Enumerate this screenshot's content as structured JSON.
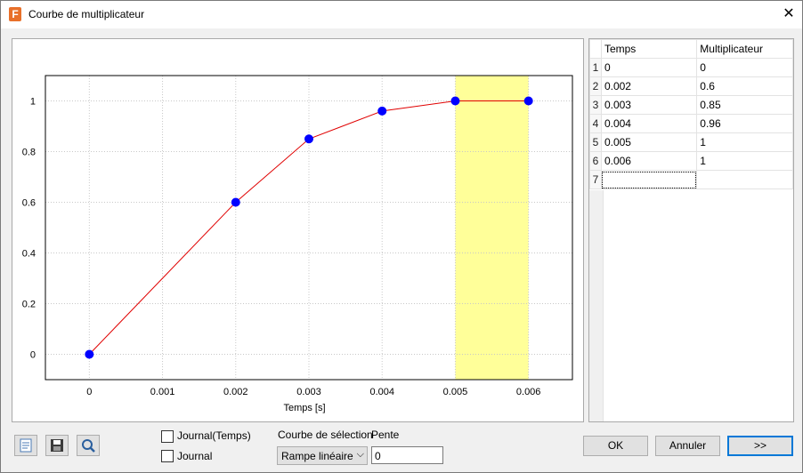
{
  "window": {
    "title": "Courbe de multiplicateur",
    "icon_letter": "F",
    "close_glyph": "✕"
  },
  "chart_data": {
    "type": "line",
    "x": [
      0,
      0.002,
      0.003,
      0.004,
      0.005,
      0.006
    ],
    "y": [
      0,
      0.6,
      0.85,
      0.96,
      1,
      1
    ],
    "xlabel": "Temps [s]",
    "ylabel": "",
    "xlim": [
      -0.0006,
      0.0066
    ],
    "ylim": [
      -0.1,
      1.1
    ],
    "x_ticks": [
      "0",
      "0.001",
      "0.002",
      "0.003",
      "0.004",
      "0.005",
      "0.006"
    ],
    "y_ticks": [
      "0",
      "0.2",
      "0.4",
      "0.6",
      "0.8",
      "1"
    ],
    "highlight_x_range": [
      0.005,
      0.006
    ],
    "line_color": "#e00000",
    "marker_color": "#0000ff",
    "highlight_color": "#ffff99",
    "grid": true
  },
  "table": {
    "headers": [
      "Temps",
      "Multiplicateur"
    ],
    "rows": [
      {
        "num": "1",
        "temps": "0",
        "mult": "0"
      },
      {
        "num": "2",
        "temps": "0.002",
        "mult": "0.6"
      },
      {
        "num": "3",
        "temps": "0.003",
        "mult": "0.85"
      },
      {
        "num": "4",
        "temps": "0.004",
        "mult": "0.96"
      },
      {
        "num": "5",
        "temps": "0.005",
        "mult": "1"
      },
      {
        "num": "6",
        "temps": "0.006",
        "mult": "1"
      },
      {
        "num": "7",
        "temps": "",
        "mult": ""
      }
    ]
  },
  "controls": {
    "journal_temps_label": "Journal(Temps)",
    "journal_label": "Journal",
    "selection_curve_label": "Courbe de sélection",
    "selection_curve_value": "Rampe linéaire",
    "slope_label": "Pente",
    "slope_value": "0"
  },
  "buttons": {
    "ok": "OK",
    "cancel": "Annuler",
    "next": ">>"
  }
}
